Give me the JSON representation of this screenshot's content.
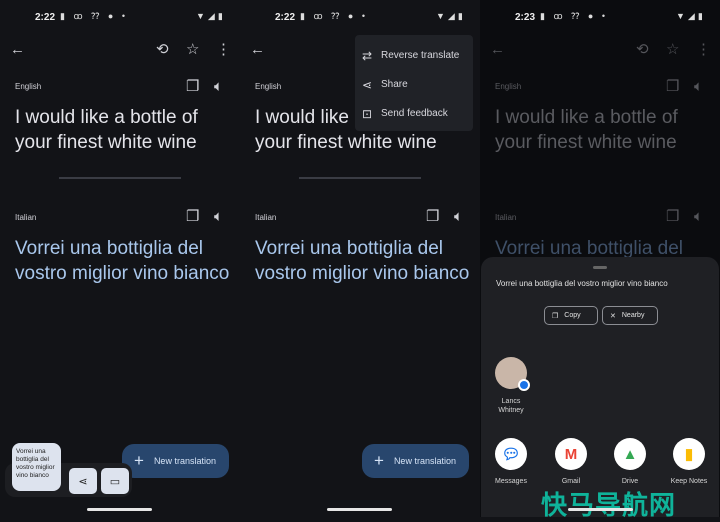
{
  "panels": [
    {
      "time": "2:22"
    },
    {
      "time": "2:22"
    },
    {
      "time": "2:23"
    }
  ],
  "source": {
    "language": "English",
    "text": "I would like a bottle of your finest white wine"
  },
  "target": {
    "language": "Italian",
    "text": "Vorrei una bottiglia del vostro miglior vino bianco"
  },
  "fab_label": "New translation",
  "clipboard_preview": "Vorrei una bottiglia del vostro miglior vino bianco",
  "menu": [
    {
      "icon": "swap-icon",
      "label": "Reverse translate"
    },
    {
      "icon": "share-icon",
      "label": "Share"
    },
    {
      "icon": "feedback-icon",
      "label": "Send feedback"
    }
  ],
  "share_sheet": {
    "text": "Vorrei una bottiglia del vostro miglior vino bianco",
    "copy_label": "Copy",
    "nearby_label": "Nearby",
    "contact": {
      "name": "Lancs Whitney"
    },
    "apps": [
      {
        "label": "Messages",
        "color": "#1a73e8"
      },
      {
        "label": "Gmail",
        "color": "#ea4335"
      },
      {
        "label": "Drive",
        "color": "#34a853"
      },
      {
        "label": "Keep Notes",
        "color": "#fbbc04"
      }
    ]
  },
  "watermark": "快马导航网",
  "colors": {
    "background": "#121317",
    "accent": "#a9c7ec",
    "fab": "#28466d"
  }
}
